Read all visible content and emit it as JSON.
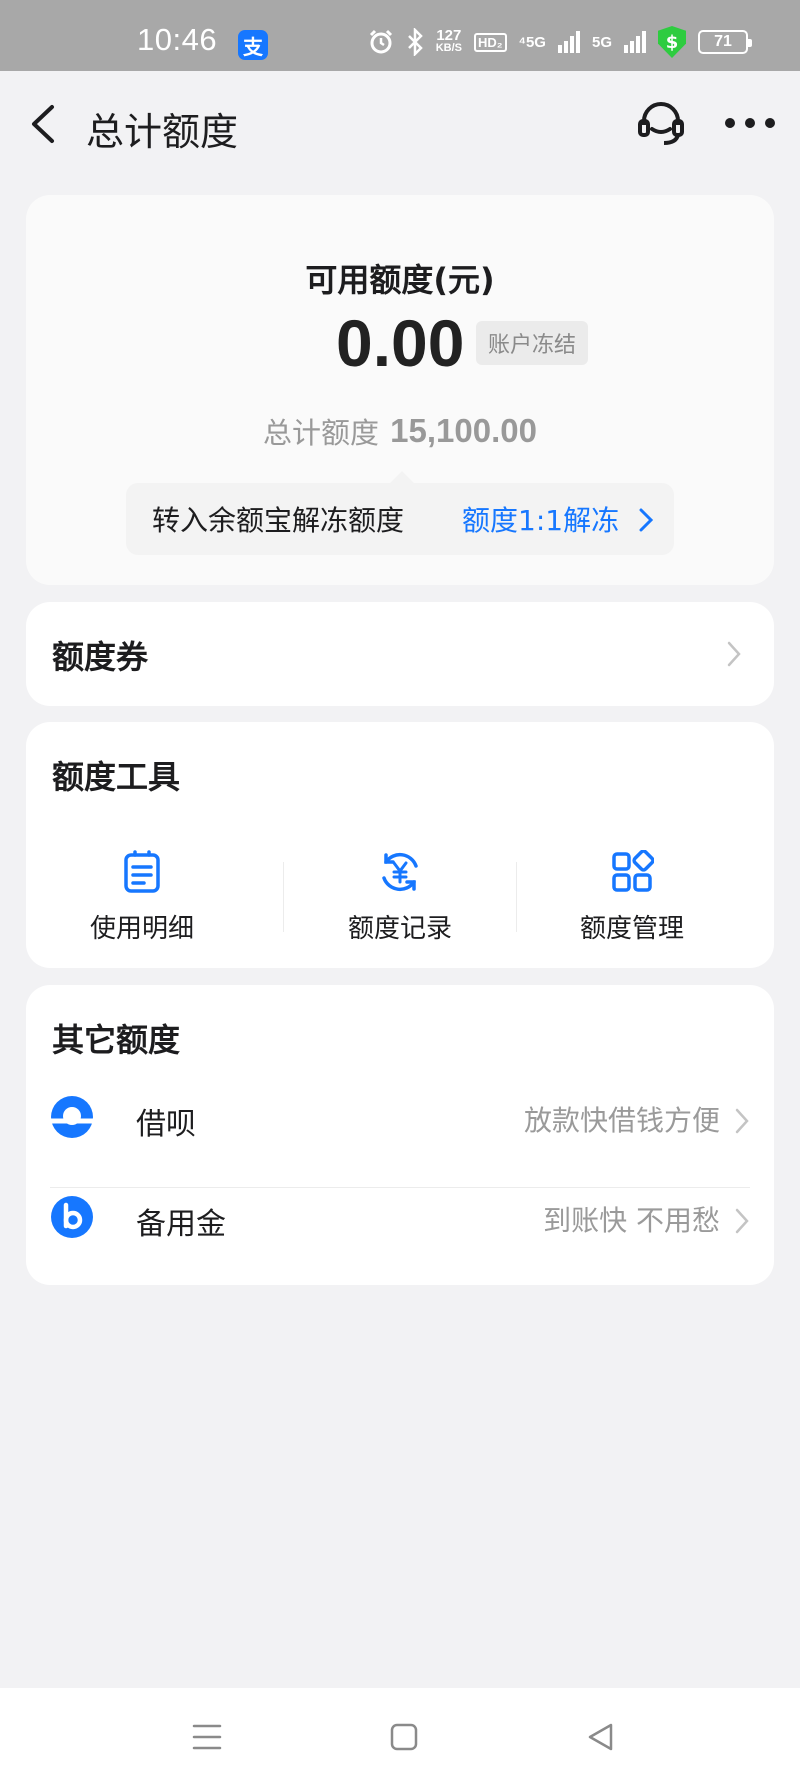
{
  "status_bar": {
    "time": "10:46",
    "app_icon": "支",
    "net_speed_value": "127",
    "net_speed_unit": "KB/S",
    "hd_label": "HD₂",
    "net1": "⁴5G",
    "net2": "5G",
    "shield_icon": "$",
    "battery": "71"
  },
  "header": {
    "title": "总计额度"
  },
  "amount_card": {
    "label": "可用额度(元)",
    "value": "0.00",
    "badge": "账户冻结",
    "total_label": "总计额度",
    "total_value": "15,100.00",
    "unfreeze_text": "转入余额宝解冻额度",
    "unfreeze_link": "额度1:1解冻"
  },
  "coupon_card": {
    "title": "额度券"
  },
  "tools_card": {
    "title": "额度工具",
    "items": [
      {
        "label": "使用明细",
        "icon": "list-icon"
      },
      {
        "label": "额度记录",
        "icon": "yuan-record-icon"
      },
      {
        "label": "额度管理",
        "icon": "grid-icon"
      }
    ]
  },
  "other_card": {
    "title": "其它额度",
    "items": [
      {
        "name": "借呗",
        "desc": "放款快借钱方便",
        "icon": "jiebei-logo"
      },
      {
        "name": "备用金",
        "desc": "到账快 不用愁",
        "icon": "beiyongjin-logo"
      }
    ]
  },
  "colors": {
    "accent": "#1677ff",
    "background": "#f2f2f4",
    "card": "#ffffff",
    "muted_text": "#9a9a9a"
  }
}
